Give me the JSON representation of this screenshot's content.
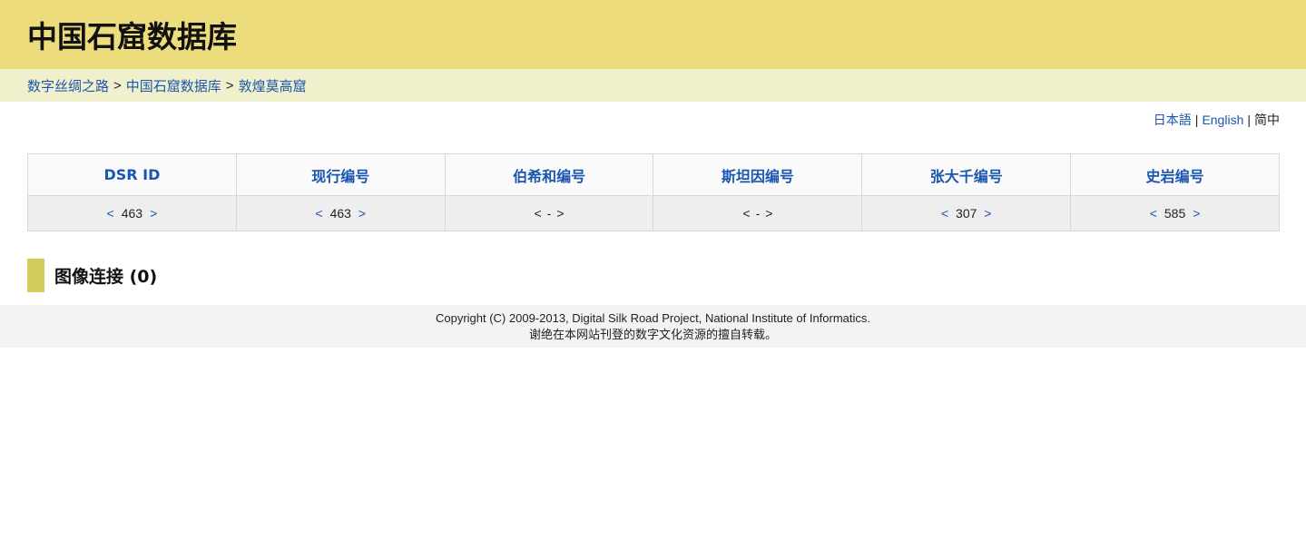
{
  "header": {
    "title": "中国石窟数据库"
  },
  "breadcrumb": {
    "items": [
      "数字丝绸之路",
      "中国石窟数据库",
      "敦煌莫高窟"
    ],
    "separator": ">"
  },
  "lang": {
    "japanese": "日本語",
    "english": "English",
    "chinese": "简中",
    "separator": "|"
  },
  "idtable": {
    "headers": [
      "DSR ID",
      "现行编号",
      "伯希和编号",
      "斯坦因编号",
      "张大千编号",
      "史岩编号"
    ],
    "prev": "<",
    "next": ">",
    "values": [
      "463",
      "463",
      "-",
      "-",
      "307",
      "585"
    ]
  },
  "section": {
    "title": "图像连接 (0)"
  },
  "footer": {
    "line1": "Copyright (C) 2009-2013, Digital Silk Road Project, National Institute of Informatics.",
    "line2": "谢绝在本网站刊登的数字文化资源的擅自转载。"
  },
  "colors": {
    "header_bg": "#ecdc7c",
    "breadcrumb_bg": "#f1f0cc",
    "link": "#1a55b0",
    "section_marker": "#d2cc5a"
  }
}
